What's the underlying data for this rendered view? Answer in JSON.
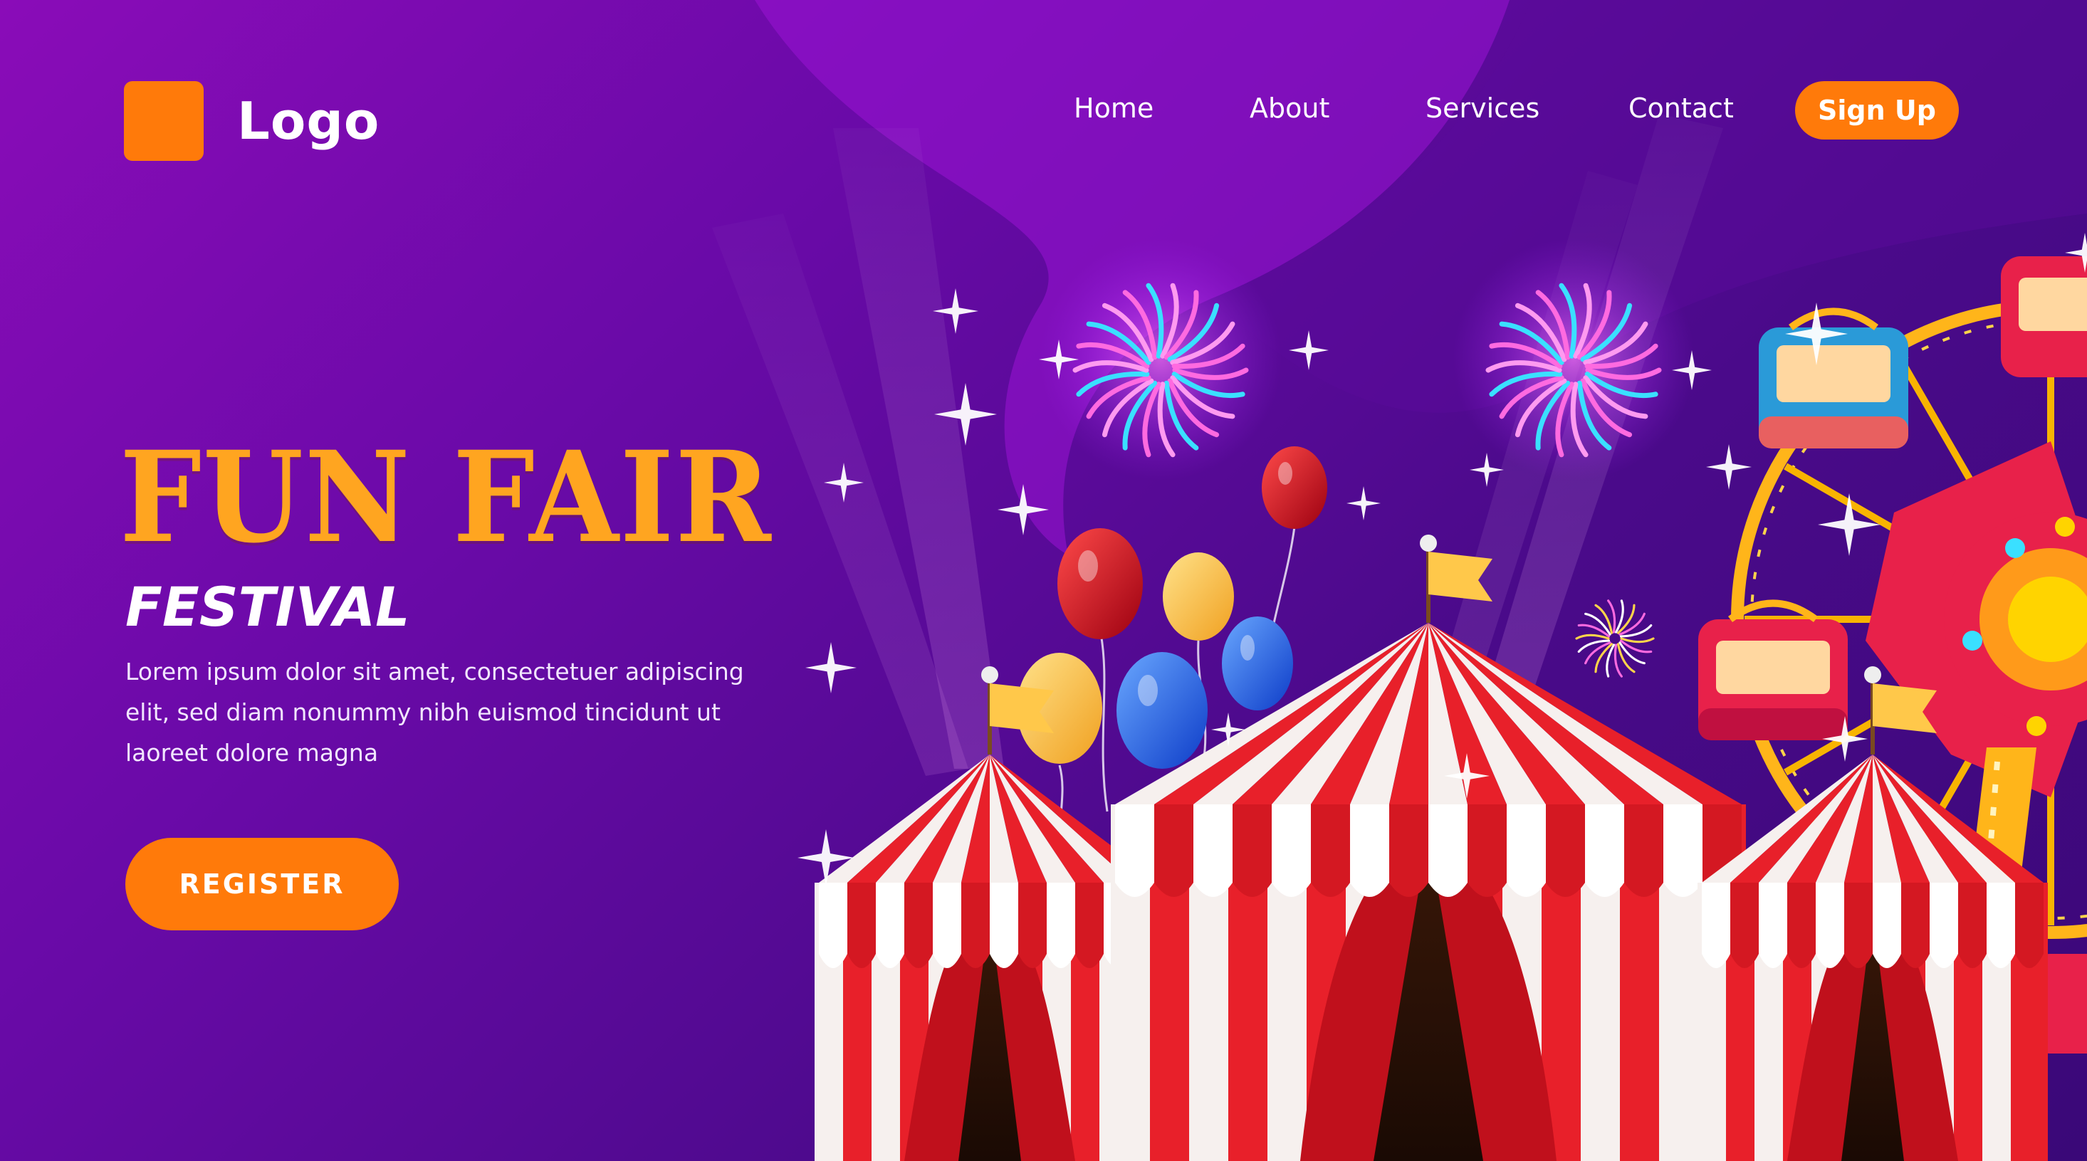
{
  "header": {
    "logo_label": "Logo",
    "nav": [
      "Home",
      "About",
      "Services",
      "Contact"
    ],
    "signup_label": "Sign Up"
  },
  "hero": {
    "title": "FUN FAIR",
    "subtitle": "FESTIVAL",
    "description": "Lorem ipsum dolor sit amet, consectetuer adipiscing elit, sed diam nonummy nibh euismod tincidunt ut laoreet dolore magna",
    "register_label": "REGISTER"
  },
  "colors": {
    "accent": "#ff7a0a",
    "title": "#ffa520",
    "tent_red": "#e8202a",
    "tent_white": "#f6f0ee",
    "background_start": "#8a0cb8",
    "background_end": "#3a0878"
  },
  "icons": {
    "logo": "square-logo-icon",
    "fireworks": "fireworks-icon",
    "balloons": "balloon-icon",
    "flags": "flag-icon",
    "ferris_wheel": "ferris-wheel-icon",
    "tents": "circus-tent-icon",
    "sparkles": "sparkle-icon"
  }
}
